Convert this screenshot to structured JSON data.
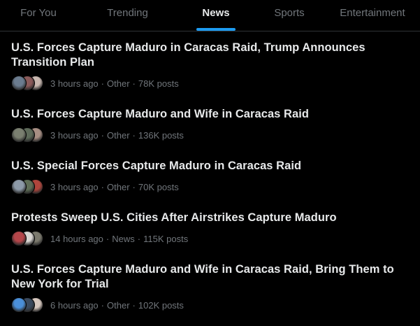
{
  "tabs": [
    {
      "label": "For You",
      "active": false
    },
    {
      "label": "Trending",
      "active": false
    },
    {
      "label": "News",
      "active": true
    },
    {
      "label": "Sports",
      "active": false
    },
    {
      "label": "Entertainment",
      "active": false
    }
  ],
  "accent_color": "#1d9bf0",
  "stories": [
    {
      "headline": "U.S. Forces Capture Maduro in Caracas Raid, Trump Announces Transition Plan",
      "time": "3 hours ago",
      "category": "Other",
      "posts": "78K posts",
      "avatar_colors": [
        "#6b7c8f",
        "#8a5a5a",
        "#c9b8b0"
      ]
    },
    {
      "headline": "U.S. Forces Capture Maduro and Wife in Caracas Raid",
      "time": "3 hours ago",
      "category": "Other",
      "posts": "136K posts",
      "avatar_colors": [
        "#7a7f70",
        "#5e6b5a",
        "#a88f84"
      ]
    },
    {
      "headline": "U.S. Special Forces Capture Maduro in Caracas Raid",
      "time": "3 hours ago",
      "category": "Other",
      "posts": "70K posts",
      "avatar_colors": [
        "#8d9aa8",
        "#5f6e57",
        "#b0453c"
      ]
    },
    {
      "headline": "Protests Sweep U.S. Cities After Airstrikes Capture Maduro",
      "time": "14 hours ago",
      "category": "News",
      "posts": "115K posts",
      "avatar_colors": [
        "#b5464a",
        "#d9d6d2",
        "#7c7a6e"
      ]
    },
    {
      "headline": "U.S. Forces Capture Maduro and Wife in Caracas Raid, Bring Them to New York for Trial",
      "time": "6 hours ago",
      "category": "Other",
      "posts": "102K posts",
      "avatar_colors": [
        "#4a8fd9",
        "#3a4a5e",
        "#d8c9c0"
      ]
    }
  ],
  "separator": "·"
}
